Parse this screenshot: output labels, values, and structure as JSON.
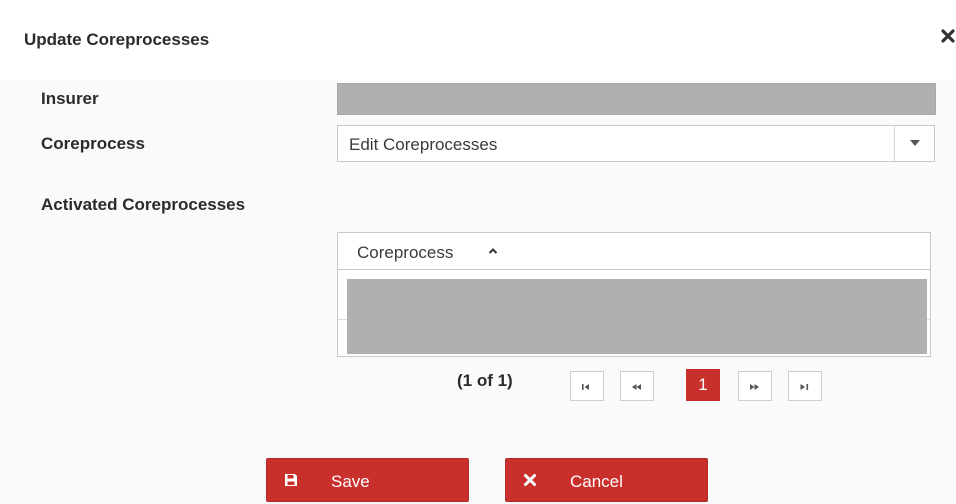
{
  "dialog": {
    "title": "Update Coreprocesses",
    "close_icon": "close-icon"
  },
  "form": {
    "insurer_label": "Insurer",
    "insurer_value": "",
    "coreprocess_label": "Coreprocess",
    "coreprocess_selected": "Edit Coreprocesses",
    "activated_label": "Activated Coreprocesses"
  },
  "table": {
    "column_header": "Coreprocess",
    "sort": "ascending",
    "rows": []
  },
  "paginator": {
    "count": "(1 of 1)",
    "current_page": "1",
    "icons": [
      "first-page-icon",
      "previous-page-icon",
      "next-page-icon",
      "last-page-icon"
    ]
  },
  "actions": {
    "save_label": "Save",
    "cancel_label": "Cancel"
  },
  "colors": {
    "accent": "#c9302c",
    "redacted": "#b0b0b0",
    "text": "#2b2b2b"
  }
}
